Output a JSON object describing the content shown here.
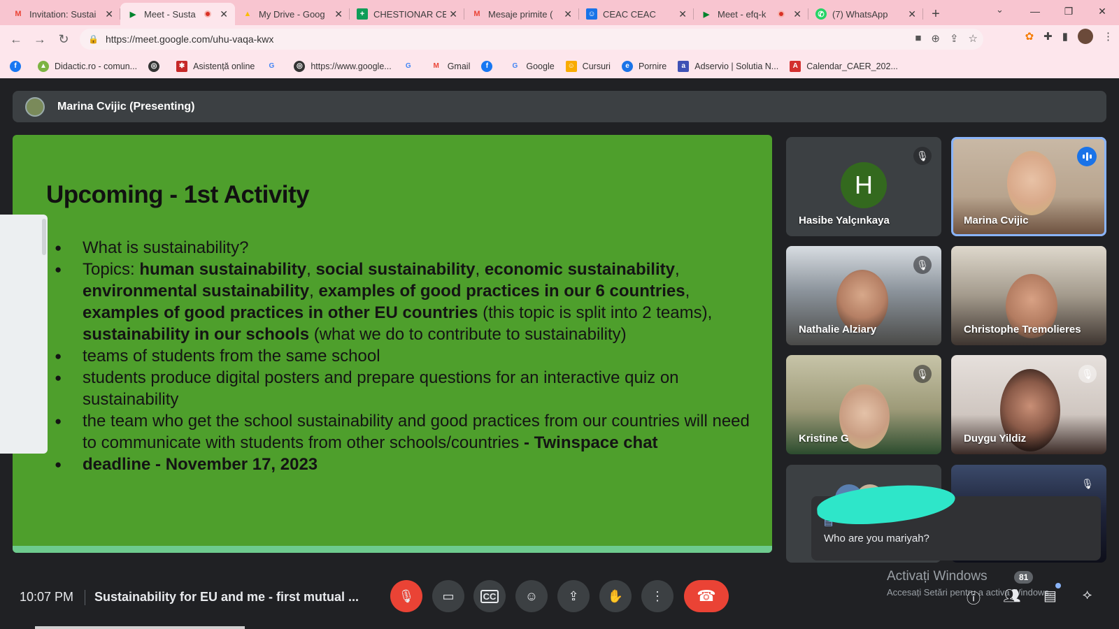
{
  "browser": {
    "tabs": [
      {
        "title": "Invitation: Sustai",
        "favicon": "gmail-icon",
        "active": false
      },
      {
        "title": "Meet - Susta",
        "favicon": "meet-icon",
        "active": true,
        "recording": true
      },
      {
        "title": "My Drive - Goog",
        "favicon": "drive-icon",
        "active": false
      },
      {
        "title": "CHESTIONAR CE",
        "favicon": "sheets-icon",
        "active": false
      },
      {
        "title": "Mesaje primite (",
        "favicon": "gmail-icon",
        "active": false
      },
      {
        "title": "CEAC CEAC",
        "favicon": "classroom-icon",
        "active": false
      },
      {
        "title": "Meet - efq-k",
        "favicon": "meet-icon",
        "active": false,
        "recording": true
      },
      {
        "title": "(7) WhatsApp",
        "favicon": "whatsapp-icon",
        "active": false
      }
    ],
    "url": "https://meet.google.com/uhu-vaqa-kwx",
    "bookmarks": [
      {
        "label": "",
        "icon": "facebook-icon",
        "color": "#1877f2"
      },
      {
        "label": "Didactic.ro - comun...",
        "icon": "didactic-icon",
        "color": "#7cb342"
      },
      {
        "label": "",
        "icon": "globe-icon",
        "color": "#333333"
      },
      {
        "label": "Asistență online",
        "icon": "asistenta-icon",
        "color": "#c62828"
      },
      {
        "label": "",
        "icon": "google-icon",
        "color": "#4285f4"
      },
      {
        "label": "https://www.google...",
        "icon": "globe-icon",
        "color": "#333333"
      },
      {
        "label": "",
        "icon": "google-icon",
        "color": "#4285f4"
      },
      {
        "label": "Gmail",
        "icon": "gmail-icon",
        "color": "#ea4335"
      },
      {
        "label": "",
        "icon": "facebook-icon",
        "color": "#1877f2"
      },
      {
        "label": "Google",
        "icon": "google-icon",
        "color": "#4285f4"
      },
      {
        "label": "Cursuri",
        "icon": "classroom-icon",
        "color": "#f9ab00"
      },
      {
        "label": "Pornire",
        "icon": "pornire-icon",
        "color": "#1a73e8"
      },
      {
        "label": "Adservio | Solutia N...",
        "icon": "adservio-icon",
        "color": "#3f51b5"
      },
      {
        "label": "Calendar_CAER_202...",
        "icon": "pdf-icon",
        "color": "#d32f2f"
      }
    ]
  },
  "meet": {
    "presenter": "Marina Cvijic (Presenting)",
    "slide": {
      "title": "Upcoming - 1st Activity",
      "b1": "What is sustainability?",
      "b2_prefix": "Topics: ",
      "b2_t1": "human sustainability",
      "b2_c1": ", ",
      "b2_t2": "social sustainability",
      "b2_c2": ", ",
      "b2_t3": "economic sustainability",
      "b2_c3": ", ",
      "b2_t4": "environmental sustainability",
      "b2_c4": ", ",
      "b2_t5": "examples of good practices in our 6 countries",
      "b2_c5": ", ",
      "b2_t6": "examples of good practices in other EU countries",
      "b2_n6": " (this topic is split into 2 teams), ",
      "b2_t7": "sustainability in our schools",
      "b2_n7": " (what we do to contribute to sustainability)",
      "b3": "teams of students from the same school",
      "b4": "students produce digital posters and prepare questions for an interactive quiz on sustainability",
      "b5": "the team who get the school sustainability and good practices from our countries will need to communicate with students from other schools/countries",
      "b5_bold": " - Twinspace chat",
      "b6": "deadline - November 17, 2023"
    },
    "participants": [
      {
        "name": "Hasibe Yalçınkaya",
        "initial": "H",
        "muted": true
      },
      {
        "name": "Marina Cvijic",
        "speaking": true
      },
      {
        "name": "Nathalie Alziary",
        "muted": true
      },
      {
        "name": "Christophe Tremolieres",
        "muted": false
      },
      {
        "name": "Kristine G",
        "muted": true
      },
      {
        "name": "Duygu Yildiz",
        "muted": true
      }
    ],
    "chat_popup": {
      "message": "Who are you mariyah?"
    },
    "bottom": {
      "time": "10:07 PM",
      "meeting_title": "Sustainability for EU and me - first mutual ...",
      "participants_count": "81"
    },
    "windows_watermark": {
      "line1": "Activați Windows",
      "line2": "Accesați Setări pentru a activa Windows."
    }
  }
}
